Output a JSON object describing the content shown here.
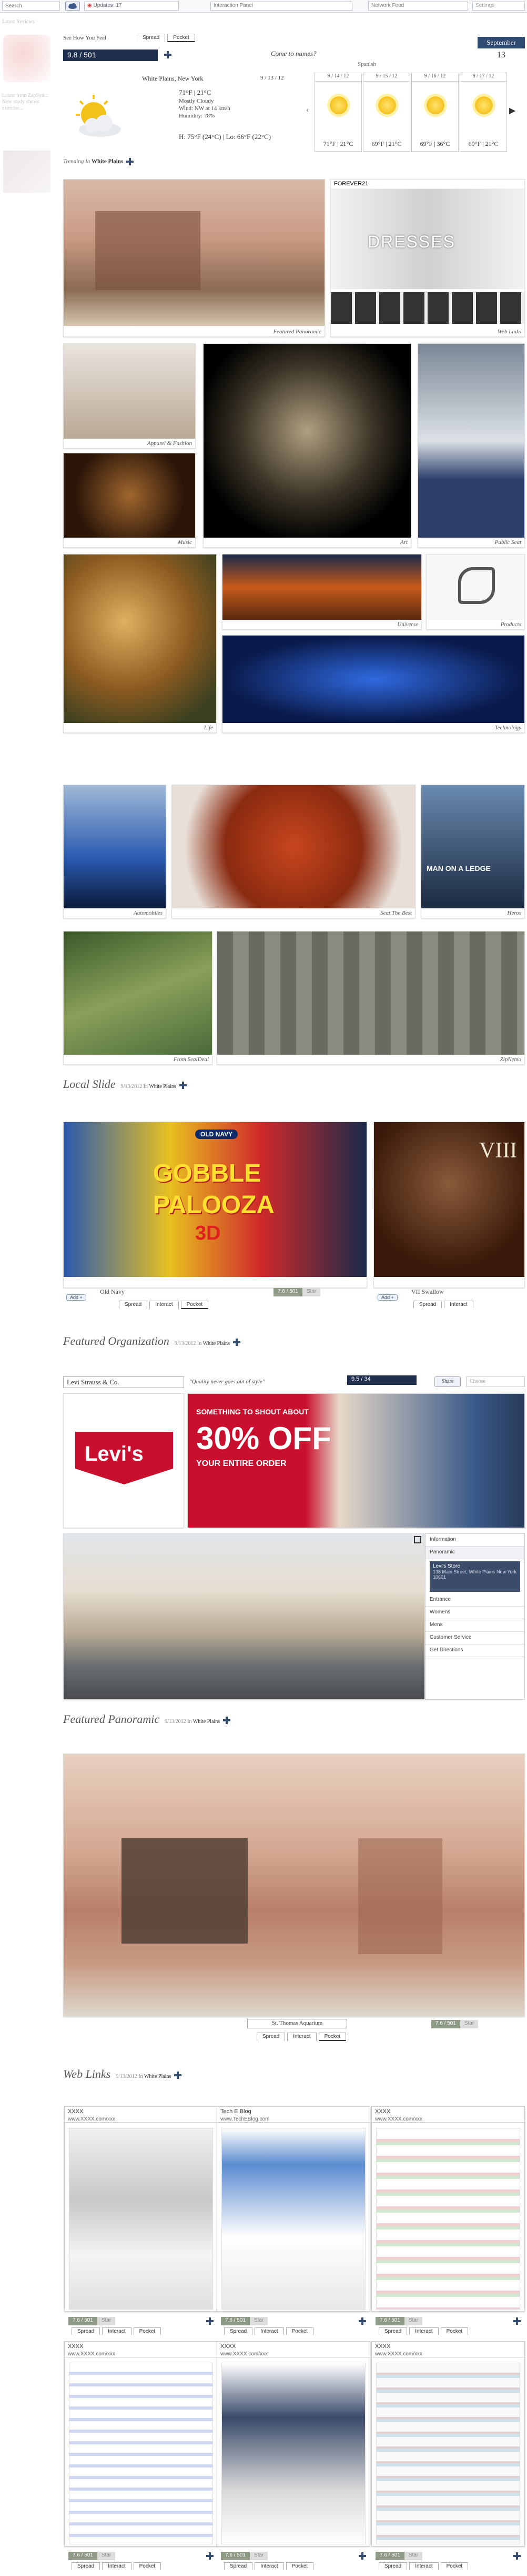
{
  "topbar": {
    "search_placeholder": "Search",
    "updates_label": "Updates: 17",
    "panel_1": "Interaction Panel",
    "panel_2": "Network Feed",
    "settings_label": "Settings"
  },
  "leftcol": {
    "label": "Latest Reviews",
    "blurb": "Latest from ZapSync: New study shows exercise..."
  },
  "header": {
    "site_tag": "See How You Feel",
    "tabs": [
      "Spread",
      "Pocket"
    ],
    "counter": "9.8 / 501",
    "quote": "Come to names?",
    "quote_sub": "Spanish",
    "month": "September",
    "day": "13"
  },
  "weather": {
    "location": "White Plains, New York",
    "date": "9 / 13 / 12",
    "temp": "71°F | 21°C",
    "condition": "Mostly Cloudy",
    "wind": "Wind: NW at 14 km/h",
    "humidity": "Humidity: 78%",
    "hilo": "H: 75°F (24°C) | Lo: 66°F (22°C)",
    "forecast": [
      {
        "date": "9 / 14 / 12",
        "temp": "71°F | 21°C"
      },
      {
        "date": "9 / 15 / 12",
        "temp": "69°F | 21°C"
      },
      {
        "date": "9 / 16 / 12",
        "temp": "69°F | 36°C"
      },
      {
        "date": "9 / 17 / 12",
        "temp": "69°F | 21°C"
      }
    ]
  },
  "trending": {
    "label": "Trending In",
    "place": "White Plains"
  },
  "tiles": {
    "featured_panoramic": "Featured Panoramic",
    "web_links": "Web Links",
    "apparel": "Apparel & Fashion",
    "art": "Art",
    "public_seat": "Public Seat",
    "music": "Music",
    "life": "Life",
    "universe": "Universe",
    "products": "Products",
    "technology": "Technology",
    "automobiles": "Automobiles",
    "seat_the_best": "Seat The Best",
    "heros": "Heros",
    "from_sealdeal": "From SealDeal",
    "zipperme": "ZipNemo"
  },
  "promo": {
    "dresses_text": "DRESSES",
    "forever21": "FOREVER21",
    "man_on_ledge": "MAN ON A LEDGE",
    "gobble_1": "GOBBLE",
    "gobble_2": "PALOOZA",
    "gobble_3": "3D",
    "old_navy_logo": "OLD NAVY",
    "viii": "VIII"
  },
  "local_slide": {
    "title": "Local Slide",
    "date": "9/13/2012 In",
    "place": "White Plains",
    "left_caption": "Old Navy",
    "right_caption": "VII Swallow",
    "counter": "7.6 / 501",
    "star": "Star",
    "add": "Add +",
    "tabs": [
      "Spread",
      "Interact",
      "Pocket"
    ]
  },
  "featured_org": {
    "title": "Featured Organization",
    "date": "9/13/2012 In",
    "place": "White Plains",
    "org_name": "Levi Strauss & Co.",
    "quote": "\"Quality never goes out of style\"",
    "counter": "9.5 / 34",
    "share": "Share",
    "dropdown": "Choose",
    "levis_logo": "Levi's",
    "ad_headline_1": "SOMETHING TO SHOUT ABOUT",
    "ad_headline_2": "30% OFF",
    "ad_headline_3": "YOUR ENTIRE ORDER",
    "menu": [
      "Information",
      "Panoramic",
      "Entrance",
      "Womens",
      "Mens",
      "Customer Service",
      "Get Directions"
    ],
    "store_name": "Levi's Store",
    "store_addr": "138 Main Street, White Plains New York 10601"
  },
  "featured_pan": {
    "title": "Featured Panoramic",
    "date": "9/13/2012 In",
    "place": "White Plains",
    "caption": "St. Thomas Aquarium",
    "counter": "7.6 / 501",
    "star": "Star",
    "tabs": [
      "Spread",
      "Interact",
      "Pocket"
    ]
  },
  "web_links": {
    "title": "Web Links",
    "date": "9/13/2012 In",
    "place": "White Plains",
    "items": [
      {
        "title": "XXXX",
        "url": "www.XXXX.com/xxx",
        "counter": "7.6 / 501"
      },
      {
        "title": "Tech E Blog",
        "url": "www.TechEBlog.com",
        "counter": "7.6 / 501"
      },
      {
        "title": "XXXX",
        "url": "www.XXXX.com/xxx",
        "counter": "7.6 / 501"
      },
      {
        "title": "XXXX",
        "url": "www.XXXX.com/xxx",
        "counter": "7.6 / 501"
      },
      {
        "title": "XXXX",
        "url": "www.XXXX.com/xxx",
        "counter": "7.6 / 501"
      },
      {
        "title": "XXXX",
        "url": "www.XXXX.com/xxx",
        "counter": "7.6 / 501"
      }
    ],
    "star": "Star",
    "tabs": [
      "Spread",
      "Interact",
      "Pocket"
    ]
  }
}
